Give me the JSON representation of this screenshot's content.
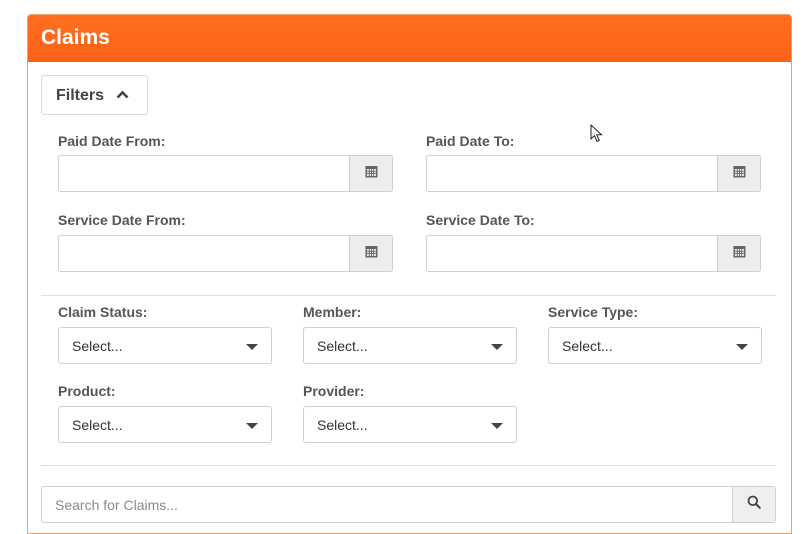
{
  "panel": {
    "title": "Claims",
    "header_color": "#ff6a1a"
  },
  "filters": {
    "toggle_label": "Filters",
    "toggle_icon": "chevron-up-icon",
    "paid_date_from": {
      "label": "Paid Date From:",
      "value": "",
      "icon": "calendar-icon"
    },
    "paid_date_to": {
      "label": "Paid Date To:",
      "value": "",
      "icon": "calendar-icon"
    },
    "service_date_from": {
      "label": "Service Date From:",
      "value": "",
      "icon": "calendar-icon"
    },
    "service_date_to": {
      "label": "Service Date To:",
      "value": "",
      "icon": "calendar-icon"
    },
    "claim_status": {
      "label": "Claim Status:",
      "selected": "Select..."
    },
    "member": {
      "label": "Member:",
      "selected": "Select..."
    },
    "service_type": {
      "label": "Service Type:",
      "selected": "Select..."
    },
    "product": {
      "label": "Product:",
      "selected": "Select..."
    },
    "provider": {
      "label": "Provider:",
      "selected": "Select..."
    }
  },
  "search": {
    "placeholder": "Search for Claims...",
    "value": "",
    "icon": "search-icon"
  }
}
